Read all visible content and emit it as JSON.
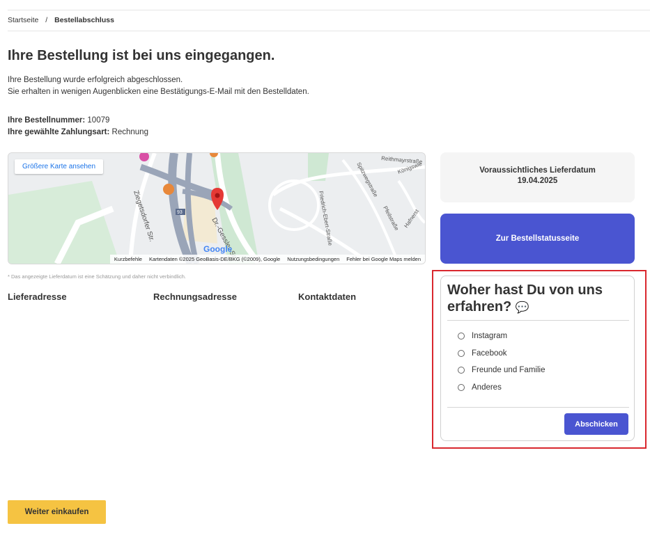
{
  "breadcrumb": {
    "home": "Startseite",
    "separator": "/",
    "current": "Bestellabschluss"
  },
  "page": {
    "title": "Ihre Bestellung ist bei uns eingegangen.",
    "message_line1": "Ihre Bestellung wurde erfolgreich abgeschlossen.",
    "message_line2": "Sie erhalten in wenigen Augenblicken eine Bestätigungs-E-Mail mit den Bestelldaten."
  },
  "order": {
    "number_label": "Ihre Bestellnummer:",
    "number_value": "10079",
    "payment_label": "Ihre gewählte Zahlungsart:",
    "payment_value": "Rechnung"
  },
  "map": {
    "larger_map_label": "Größere Karte ansehen",
    "google_logo": "Google",
    "footer": [
      "Kurzbefehle",
      "Kartendaten ©2025 GeoBasis-DE/BKG (©2009), Google",
      "Nutzungsbedingungen",
      "Fehler bei Google Maps melden"
    ],
    "labels": {
      "ziegetsdorfer": "Ziegetsdorfer Str.",
      "gessler": "Dr.-Gessler-Str.",
      "ebert": "Friedrich-Ebert-Straße",
      "reithmayr": "Reithmayrstraße",
      "spitzweg": "Spitzwegstraße",
      "pfeil": "Pfeilstraße",
      "koenigs": "Königswie",
      "hafner": "Hafnerst",
      "road93": "93"
    }
  },
  "note": "* Das angezeigte Lieferdatum ist eine Schätzung und daher nicht verbindlich.",
  "addresses": {
    "delivery": "Lieferadresse",
    "billing": "Rechnungsadresse",
    "contact": "Kontaktdaten"
  },
  "delivery_box": {
    "label": "Voraussichtliches Lieferdatum",
    "date": "19.04.2025"
  },
  "status_button": "Zur Bestellstatusseite",
  "survey": {
    "title_line1": "Woher hast Du von uns",
    "title_line2": "erfahren?",
    "options": [
      "Instagram",
      "Facebook",
      "Freunde und Familie",
      "Anderes"
    ],
    "submit": "Abschicken"
  },
  "continue_button": "Weiter einkaufen",
  "colors": {
    "primary": "#4a55d1",
    "accent_yellow": "#f5c342",
    "highlight_red": "#d9272e"
  }
}
